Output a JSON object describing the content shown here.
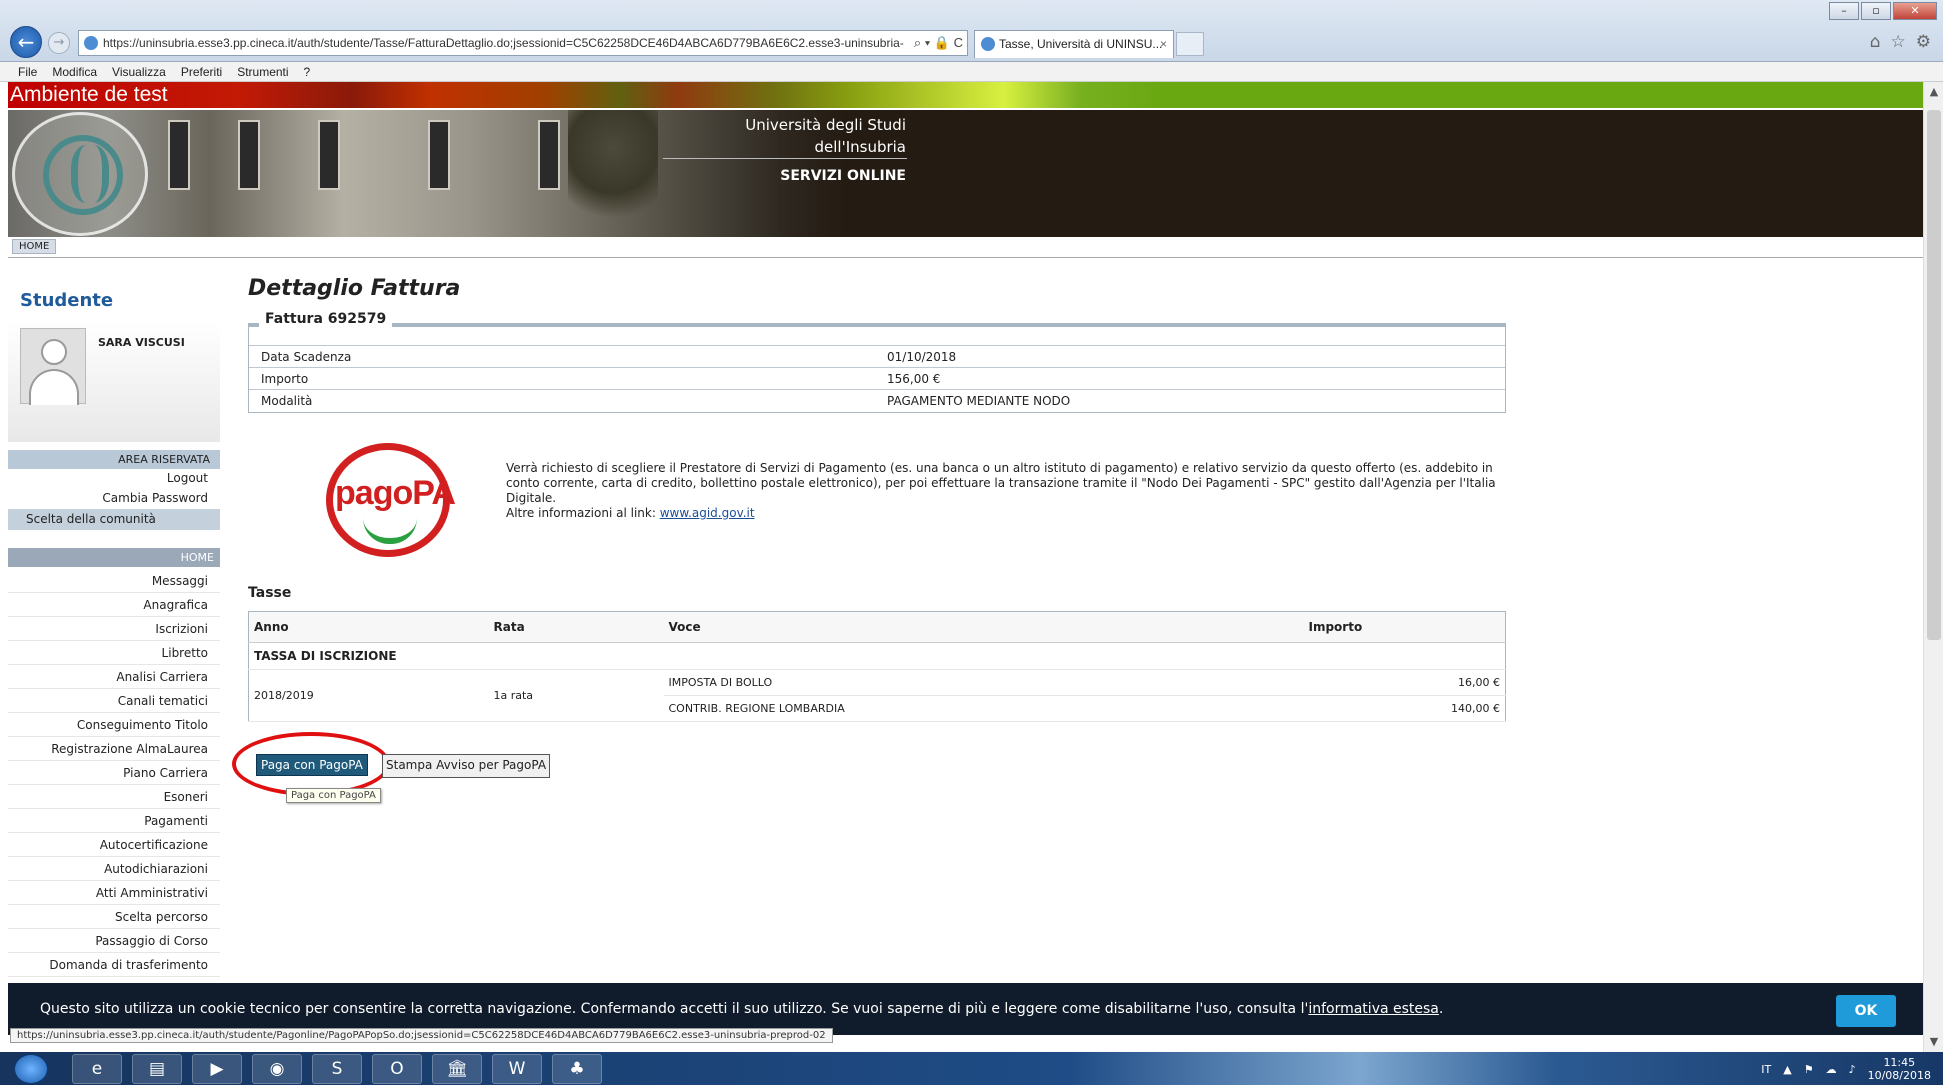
{
  "browser": {
    "url": "https://uninsubria.esse3.pp.cineca.it/auth/studente/Tasse/FatturaDettaglio.do;jsessionid=C5C62258DCE46D4ABCA6D779BA6E6C2.esse3-uninsubria-",
    "tab_title": "Tasse, Università di UNINSU...",
    "tab_close": "×",
    "addr_tools": "⌕ ▾ 🔒 C",
    "menu": [
      "File",
      "Modifica",
      "Visualizza",
      "Preferiti",
      "Strumenti",
      "?"
    ]
  },
  "banner": {
    "test_env": "Ambiente de test",
    "university_line1": "Università degli Studi",
    "university_line2": "dell'Insubria",
    "servizi": "SERVIZI ONLINE",
    "home_tab": "HOME"
  },
  "sidebar": {
    "title": "Studente",
    "user_name": "SARA VISCUSI",
    "area_riservata": "AREA RISERVATA",
    "logout": "Logout",
    "cambia_password": "Cambia Password",
    "scelta_comunita": "Scelta della comunità",
    "home": "HOME",
    "nav": [
      "Messaggi",
      "Anagrafica",
      "Iscrizioni",
      "Libretto",
      "Analisi Carriera",
      "Canali tematici",
      "Conseguimento Titolo",
      "Registrazione AlmaLaurea",
      "Piano Carriera",
      "Esoneri",
      "Pagamenti",
      "Autocertificazione",
      "Autodichiarazioni",
      "Atti Amministrativi",
      "Scelta percorso",
      "Passaggio di Corso",
      "Domanda di trasferimento"
    ]
  },
  "main": {
    "page_title": "Dettaglio Fattura",
    "fattura_label": "Fattura 692579",
    "details": [
      {
        "label": "Data Scadenza",
        "value": "01/10/2018"
      },
      {
        "label": "Importo",
        "value": "156,00 €"
      },
      {
        "label": "Modalità",
        "value": "PAGAMENTO MEDIANTE NODO"
      }
    ],
    "pagopa_logo": "pagoPA",
    "pagopa_text": "Verrà richiesto di scegliere il Prestatore di Servizi di Pagamento (es. una banca o un altro istituto di pagamento) e relativo servizio da questo offerto (es. addebito in conto corrente, carta di credito, bollettino postale elettronico), per poi effettuare la transazione tramite il \"Nodo Dei Pagamenti - SPC\" gestito dall'Agenzia per l'Italia Digitale.",
    "pagopa_more": "Altre informazioni al link:",
    "pagopa_link": "www.agid.gov.it",
    "tasse_title": "Tasse",
    "tasse_headers": [
      "Anno",
      "Rata",
      "Voce",
      "Importo"
    ],
    "tasse_group": "TASSA DI ISCRIZIONE",
    "tasse_anno": "2018/2019",
    "tasse_rata": "1a rata",
    "tasse_rows": [
      {
        "voce": "IMPOSTA DI BOLLO",
        "importo": "16,00 €"
      },
      {
        "voce": "CONTRIB. REGIONE LOMBARDIA",
        "importo": "140,00 €"
      }
    ],
    "btn_pago": "Paga con PagoPA",
    "btn_stampa": "Stampa Avviso per PagoPA",
    "tooltip": "Paga con PagoPA"
  },
  "cookie": {
    "text": "Questo sito utilizza un cookie tecnico per consentire la corretta navigazione. Confermando accetti il suo utilizzo. Se vuoi saperne di più e leggere come disabilitarne l'uso, consulta l'",
    "link": "informativa estesa",
    "end": ".",
    "ok": "OK"
  },
  "status_url": "https://uninsubria.esse3.pp.cineca.it/auth/studente/Pagonline/PagoPAPopSo.do;jsessionid=C5C62258DCE46D4ABCA6D779BA6E6C2.esse3-uninsubria-preprod-02",
  "taskbar": {
    "lang": "IT",
    "time": "11:45",
    "date": "10/08/2018"
  }
}
